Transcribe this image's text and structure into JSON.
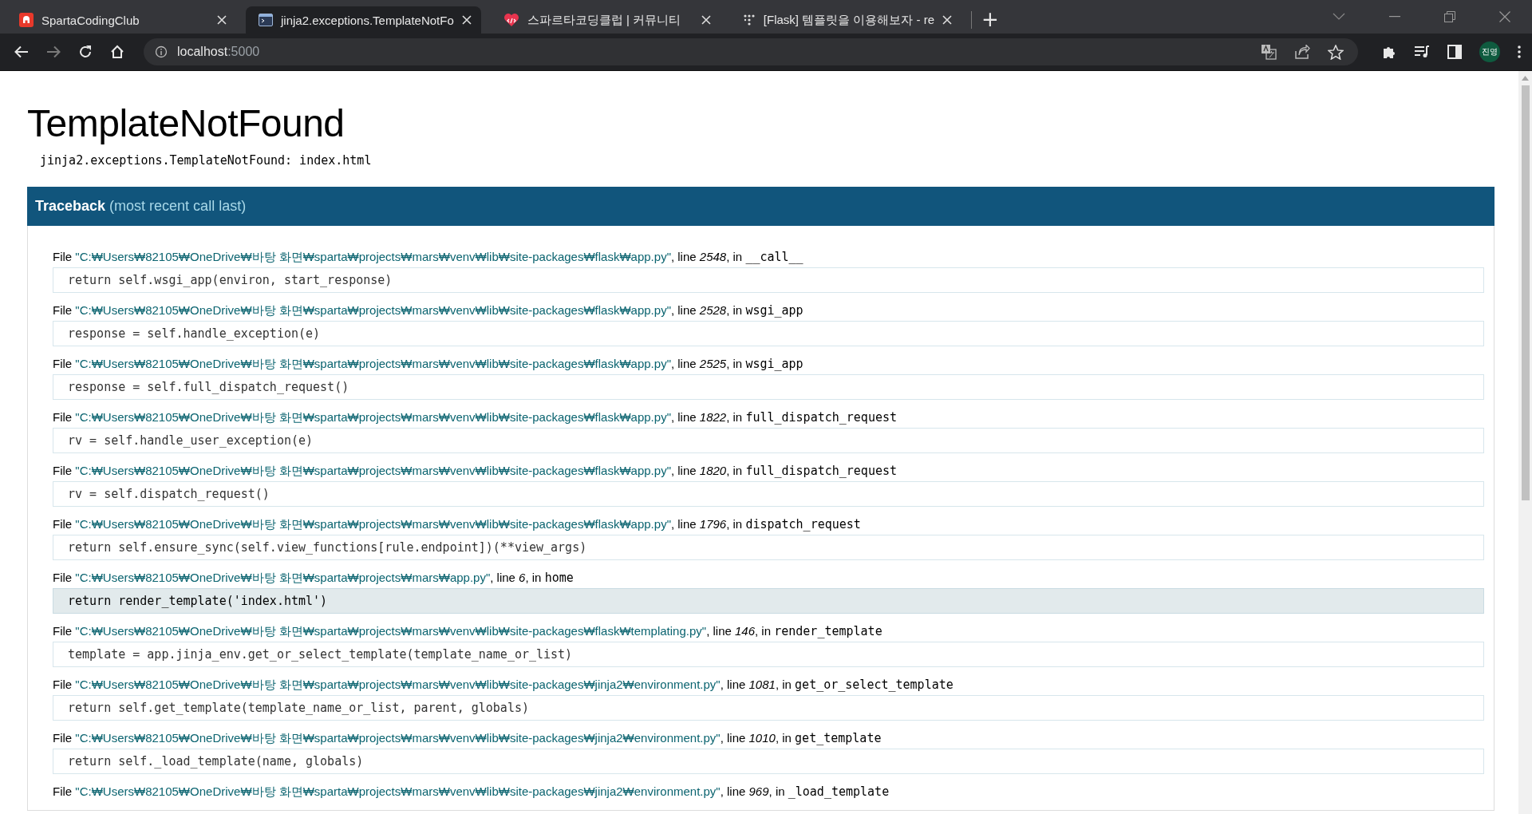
{
  "browser": {
    "tabs": [
      {
        "title": "SpartaCodingClub",
        "selected": false
      },
      {
        "title": "jinja2.exceptions.TemplateNotFo",
        "selected": true
      },
      {
        "title": "스파르타코딩클럽 | 커뮤니티",
        "selected": false
      },
      {
        "title": "[Flask] 템플릿을 이용해보자 - re",
        "selected": false
      }
    ],
    "new_tab": "+",
    "address": {
      "host": "localhost",
      "port": ":5000"
    },
    "profile": "진영"
  },
  "page": {
    "title": "TemplateNotFound",
    "message": "jinja2.exceptions.TemplateNotFound: index.html",
    "traceback": {
      "title": "Traceback",
      "note": "(most recent call last)",
      "frames": [
        {
          "file_label": "File",
          "file": "\"C:₩Users₩82105₩OneDrive₩바탕 화면₩sparta₩projects₩mars₩venv₩lib₩site-packages₩flask₩app.py\"",
          "line_label": ", line",
          "line": "2548",
          "in_label": ", in",
          "function": "__call__",
          "code": "return self.wsgi_app(environ, start_response)",
          "current": false
        },
        {
          "file_label": "File",
          "file": "\"C:₩Users₩82105₩OneDrive₩바탕 화면₩sparta₩projects₩mars₩venv₩lib₩site-packages₩flask₩app.py\"",
          "line_label": ", line",
          "line": "2528",
          "in_label": ", in",
          "function": "wsgi_app",
          "code": "response = self.handle_exception(e)",
          "current": false
        },
        {
          "file_label": "File",
          "file": "\"C:₩Users₩82105₩OneDrive₩바탕 화면₩sparta₩projects₩mars₩venv₩lib₩site-packages₩flask₩app.py\"",
          "line_label": ", line",
          "line": "2525",
          "in_label": ", in",
          "function": "wsgi_app",
          "code": "response = self.full_dispatch_request()",
          "current": false
        },
        {
          "file_label": "File",
          "file": "\"C:₩Users₩82105₩OneDrive₩바탕 화면₩sparta₩projects₩mars₩venv₩lib₩site-packages₩flask₩app.py\"",
          "line_label": ", line",
          "line": "1822",
          "in_label": ", in",
          "function": "full_dispatch_request",
          "code": "rv = self.handle_user_exception(e)",
          "current": false
        },
        {
          "file_label": "File",
          "file": "\"C:₩Users₩82105₩OneDrive₩바탕 화면₩sparta₩projects₩mars₩venv₩lib₩site-packages₩flask₩app.py\"",
          "line_label": ", line",
          "line": "1820",
          "in_label": ", in",
          "function": "full_dispatch_request",
          "code": "rv = self.dispatch_request()",
          "current": false
        },
        {
          "file_label": "File",
          "file": "\"C:₩Users₩82105₩OneDrive₩바탕 화면₩sparta₩projects₩mars₩venv₩lib₩site-packages₩flask₩app.py\"",
          "line_label": ", line",
          "line": "1796",
          "in_label": ", in",
          "function": "dispatch_request",
          "code": "return self.ensure_sync(self.view_functions[rule.endpoint])(**view_args)",
          "current": false
        },
        {
          "file_label": "File",
          "file": "\"C:₩Users₩82105₩OneDrive₩바탕 화면₩sparta₩projects₩mars₩app.py\"",
          "line_label": ", line",
          "line": "6",
          "in_label": ", in",
          "function": "home",
          "code": "return render_template('index.html')",
          "current": true
        },
        {
          "file_label": "File",
          "file": "\"C:₩Users₩82105₩OneDrive₩바탕 화면₩sparta₩projects₩mars₩venv₩lib₩site-packages₩flask₩templating.py\"",
          "line_label": ", line",
          "line": "146",
          "in_label": ", in",
          "function": "render_template",
          "code": "template = app.jinja_env.get_or_select_template(template_name_or_list)",
          "current": false
        },
        {
          "file_label": "File",
          "file": "\"C:₩Users₩82105₩OneDrive₩바탕 화면₩sparta₩projects₩mars₩venv₩lib₩site-packages₩jinja2₩environment.py\"",
          "line_label": ", line",
          "line": "1081",
          "in_label": ", in",
          "function": "get_or_select_template",
          "code": "return self.get_template(template_name_or_list, parent, globals)",
          "current": false
        },
        {
          "file_label": "File",
          "file": "\"C:₩Users₩82105₩OneDrive₩바탕 화면₩sparta₩projects₩mars₩venv₩lib₩site-packages₩jinja2₩environment.py\"",
          "line_label": ", line",
          "line": "1010",
          "in_label": ", in",
          "function": "get_template",
          "code": "return self._load_template(name, globals)",
          "current": false
        },
        {
          "file_label": "File",
          "file": "\"C:₩Users₩82105₩OneDrive₩바탕 화면₩sparta₩projects₩mars₩venv₩lib₩site-packages₩jinja2₩environment.py\"",
          "line_label": ", line",
          "line": "969",
          "in_label": ", in",
          "function": "_load_template"
        }
      ]
    }
  }
}
